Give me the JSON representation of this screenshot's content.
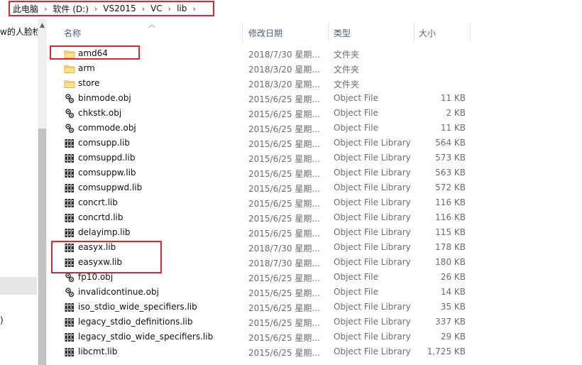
{
  "address": {
    "crumbs": [
      "此电脑",
      "软件 (D:)",
      "VS2015",
      "VC",
      "lib"
    ],
    "separator": "›"
  },
  "nav": {
    "partial_item": "w的人脸检",
    "partial_paren": ")",
    "scroll_up": "▲"
  },
  "columns": {
    "sort_arrow": "︿",
    "name": "名称",
    "date": "修改日期",
    "type": "类型",
    "size": "大小"
  },
  "files": [
    {
      "name": "amd64",
      "date": "2018/7/30 星期...",
      "type": "文件夹",
      "size": "",
      "icon": "folder-icon"
    },
    {
      "name": "arm",
      "date": "2018/3/20 星期...",
      "type": "文件夹",
      "size": "",
      "icon": "folder-icon"
    },
    {
      "name": "store",
      "date": "2018/3/20 星期...",
      "type": "文件夹",
      "size": "",
      "icon": "folder-icon"
    },
    {
      "name": "binmode.obj",
      "date": "2015/6/25 星期...",
      "type": "Object File",
      "size": "11 KB",
      "icon": "object-file-icon"
    },
    {
      "name": "chkstk.obj",
      "date": "2015/6/25 星期...",
      "type": "Object File",
      "size": "2 KB",
      "icon": "object-file-icon"
    },
    {
      "name": "commode.obj",
      "date": "2015/6/25 星期...",
      "type": "Object File",
      "size": "11 KB",
      "icon": "object-file-icon"
    },
    {
      "name": "comsupp.lib",
      "date": "2015/6/25 星期...",
      "type": "Object File Library",
      "size": "564 KB",
      "icon": "library-file-icon"
    },
    {
      "name": "comsuppd.lib",
      "date": "2015/6/25 星期...",
      "type": "Object File Library",
      "size": "573 KB",
      "icon": "library-file-icon"
    },
    {
      "name": "comsuppw.lib",
      "date": "2015/6/25 星期...",
      "type": "Object File Library",
      "size": "563 KB",
      "icon": "library-file-icon"
    },
    {
      "name": "comsuppwd.lib",
      "date": "2015/6/25 星期...",
      "type": "Object File Library",
      "size": "572 KB",
      "icon": "library-file-icon"
    },
    {
      "name": "concrt.lib",
      "date": "2015/6/25 星期...",
      "type": "Object File Library",
      "size": "116 KB",
      "icon": "library-file-icon"
    },
    {
      "name": "concrtd.lib",
      "date": "2015/6/25 星期...",
      "type": "Object File Library",
      "size": "116 KB",
      "icon": "library-file-icon"
    },
    {
      "name": "delayimp.lib",
      "date": "2015/6/25 星期...",
      "type": "Object File Library",
      "size": "115 KB",
      "icon": "library-file-icon"
    },
    {
      "name": "easyx.lib",
      "date": "2018/7/30 星期...",
      "type": "Object File Library",
      "size": "178 KB",
      "icon": "library-file-icon"
    },
    {
      "name": "easyxw.lib",
      "date": "2018/7/30 星期...",
      "type": "Object File Library",
      "size": "180 KB",
      "icon": "library-file-icon"
    },
    {
      "name": "fp10.obj",
      "date": "2015/6/25 星期...",
      "type": "Object File",
      "size": "26 KB",
      "icon": "object-file-icon"
    },
    {
      "name": "invalidcontinue.obj",
      "date": "2015/6/25 星期...",
      "type": "Object File",
      "size": "14 KB",
      "icon": "object-file-icon"
    },
    {
      "name": "iso_stdio_wide_specifiers.lib",
      "date": "2015/6/25 星期...",
      "type": "Object File Library",
      "size": "35 KB",
      "icon": "library-file-icon"
    },
    {
      "name": "legacy_stdio_definitions.lib",
      "date": "2015/6/25 星期...",
      "type": "Object File Library",
      "size": "337 KB",
      "icon": "library-file-icon"
    },
    {
      "name": "legacy_stdio_wide_specifiers.lib",
      "date": "2015/6/25 星期...",
      "type": "Object File Library",
      "size": "29 KB",
      "icon": "library-file-icon"
    },
    {
      "name": "libcmt.lib",
      "date": "2015/6/25 星期...",
      "type": "Object File Library",
      "size": "1,725 KB",
      "icon": "library-file-icon"
    }
  ],
  "colors": {
    "highlight": "#e0262f",
    "folder": "#f8d775",
    "header_text": "#4c607a",
    "meta_text": "#6d6d6d"
  }
}
